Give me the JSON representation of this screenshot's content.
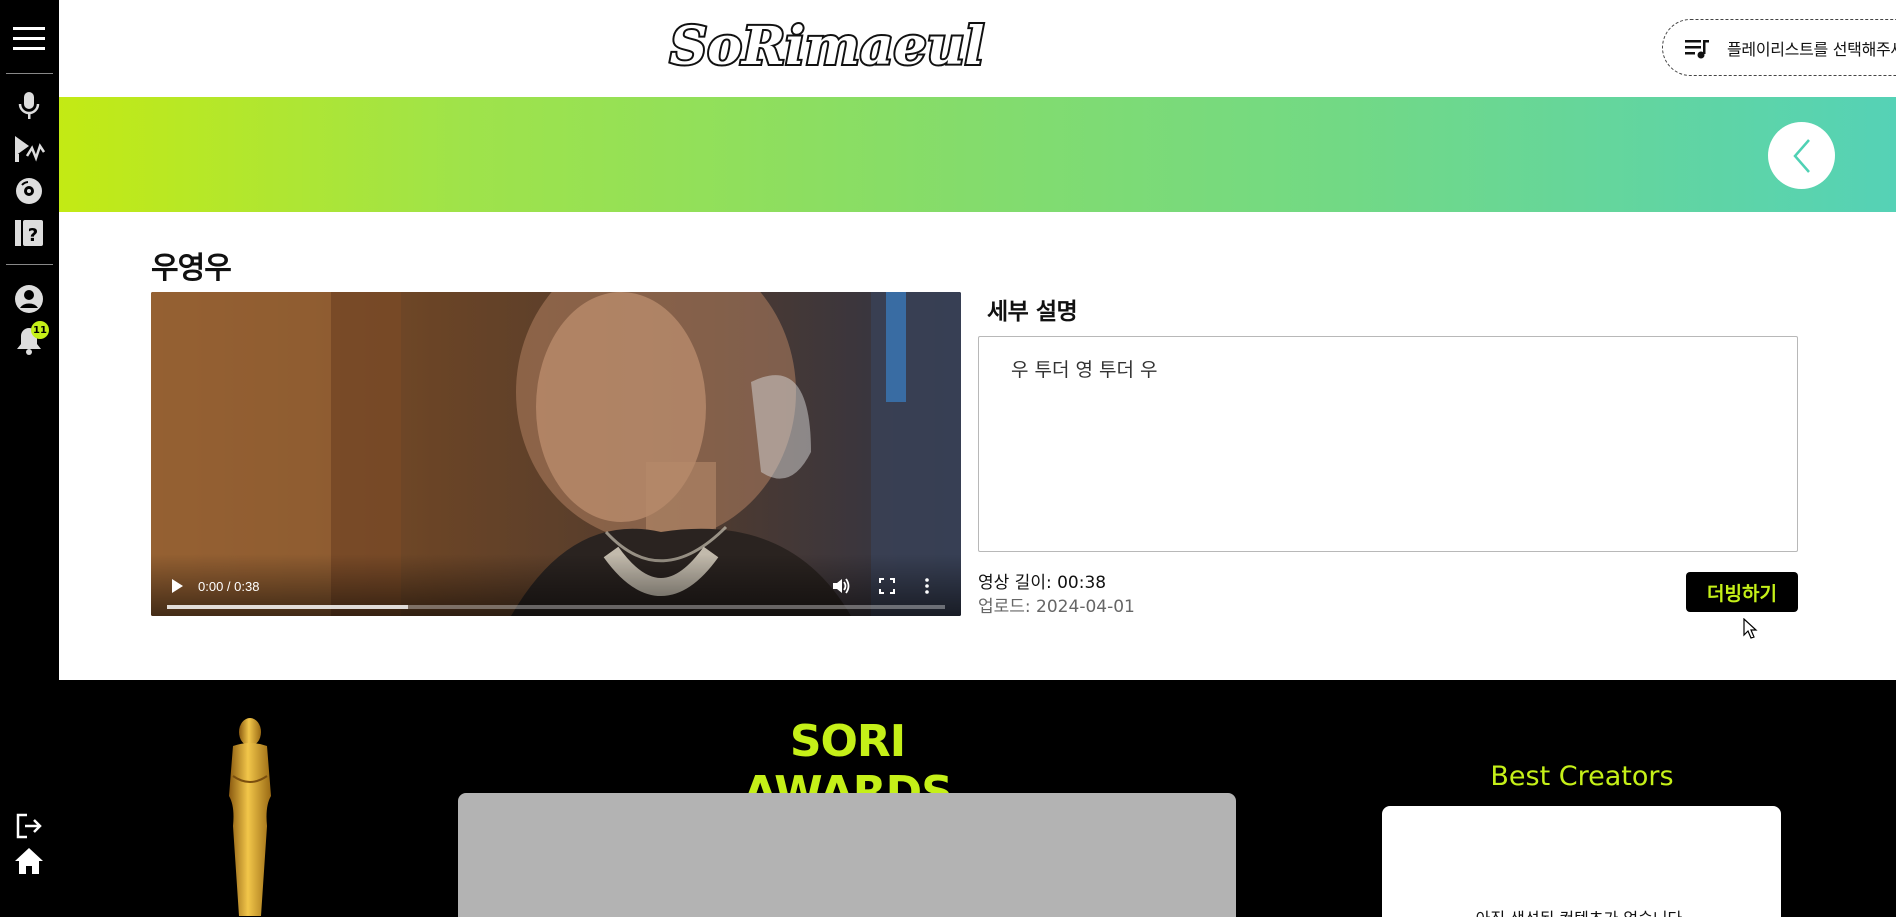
{
  "header": {
    "logo_text": "SoRimaeul",
    "playlist_label": "플레이리스트를 선택해주세요."
  },
  "sidebar": {
    "items": [
      {
        "name": "menu-icon"
      },
      {
        "name": "microphone-icon"
      },
      {
        "name": "dubbing-icon"
      },
      {
        "name": "disc-icon"
      },
      {
        "name": "help-icon"
      },
      {
        "name": "profile-icon"
      },
      {
        "name": "bell-icon"
      },
      {
        "name": "logout-icon"
      },
      {
        "name": "home-icon"
      }
    ],
    "notification_count": "11"
  },
  "content": {
    "title": "우영우",
    "video": {
      "time": "0:00 / 0:38",
      "progress": 0.31
    },
    "detail_label": "세부 설명",
    "detail_text": "우 투더 영 투더 우",
    "duration": "영상 길이: 00:38",
    "upload_date": "업로드: 2024-04-01",
    "dub_button": "더빙하기"
  },
  "awards": {
    "title": "SORI AWARDS",
    "creators_title": "Best Creators",
    "creators_empty": "아직 생성된 컨텐츠가 없습니다."
  },
  "colors": {
    "accent": "#c5f018",
    "banner_start": "#c3ea14",
    "banner_end": "#55d2b6"
  }
}
